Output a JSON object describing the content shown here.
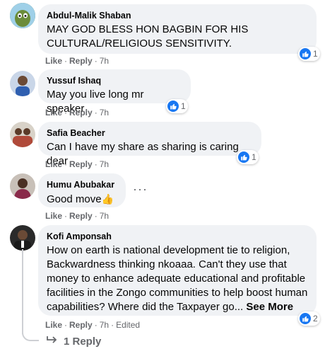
{
  "comments": [
    {
      "author": "Abdul-Malik Shaban",
      "text": "MAY GOD BLESS HON BAGBIN FOR HIS CULTURAL/RELIGIOUS SENSITIVITY.",
      "like": "Like",
      "reply": "Reply",
      "time": "7h",
      "reactions": "1"
    },
    {
      "author": "Yussuf Ishaq",
      "text": "May you live long mr speaker",
      "like": "Like",
      "reply": "Reply",
      "time": "7h",
      "reactions": "1"
    },
    {
      "author": "Safia Beacher",
      "text": "Can I have my share as sharing is caring dear",
      "like": "Like",
      "reply": "Reply",
      "time": "7h",
      "reactions": "1"
    },
    {
      "author": "Humu Abubakar",
      "text": "Good move",
      "emoji": "👍",
      "like": "Like",
      "reply": "Reply",
      "time": "7h",
      "more": "···"
    },
    {
      "author": "Kofi Amponsah",
      "text": "How on earth is national development tie to religion, Backwardness thinking nkoaaa. Can't they use that money to enhance adequate educational and profitable facilities in the Zongo communities to help boost human capabilities? Where did the Taxpayer go...",
      "see_more": "See More",
      "like": "Like",
      "reply": "Reply",
      "time": "7h",
      "edited": "Edited",
      "reactions": "2"
    }
  ],
  "replies_link": "1 Reply",
  "colors": {
    "bubble": "#f0f2f5",
    "like_blue": "#1877f2",
    "meta_gray": "#65676b"
  },
  "icons": [
    "like-reaction-icon",
    "reply-arrow-icon",
    "more-options-icon"
  ]
}
